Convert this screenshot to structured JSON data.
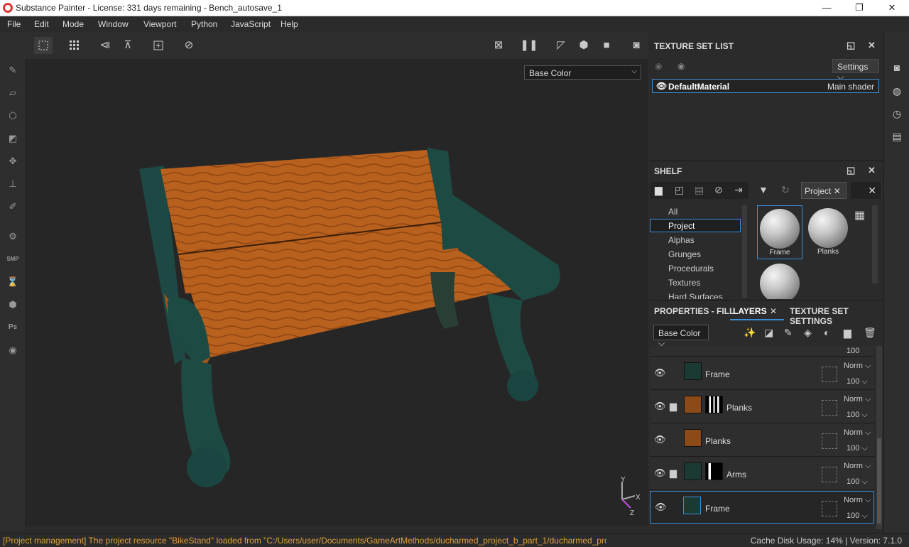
{
  "window": {
    "title": "Substance Painter - License: 331 days remaining - Bench_autosave_1",
    "minimize": "—",
    "maximize": "❐",
    "close": "✕"
  },
  "menu": [
    "File",
    "Edit",
    "Mode",
    "Window",
    "Viewport",
    "Python",
    "JavaScript",
    "Help"
  ],
  "viewport": {
    "channel": "Base Color",
    "axis_y": "Y",
    "axis_x": "X",
    "axis_z": "Z"
  },
  "texture_set_list": {
    "title": "TEXTURE SET LIST",
    "settings": "Settings",
    "items": [
      {
        "name": "DefaultMaterial",
        "shader": "Main shader"
      }
    ]
  },
  "shelf": {
    "title": "SHELF",
    "categories": [
      "All",
      "Project",
      "Alphas",
      "Grunges",
      "Procedurals",
      "Textures",
      "Hard Surfaces"
    ],
    "selected_category": "Project",
    "search_tag": "Project",
    "materials": [
      "Frame",
      "Planks"
    ]
  },
  "layers_panel": {
    "tabs": [
      "PROPERTIES - FILL",
      "LAYERS",
      "TEXTURE SET SETTINGS"
    ],
    "channel": "Base Color",
    "top_partial_opacity": "100",
    "layers": [
      {
        "name": "Frame",
        "blend": "Norm",
        "opacity": "100",
        "color": "#1b3a33",
        "folder": false,
        "mask": false
      },
      {
        "name": "Planks",
        "blend": "Norm",
        "opacity": "100",
        "color": "#8b4a18",
        "folder": true,
        "mask": true
      },
      {
        "name": "Planks",
        "blend": "Norm",
        "opacity": "100",
        "color": "#8b4a18",
        "folder": false,
        "mask": false
      },
      {
        "name": "Arms",
        "blend": "Norm",
        "opacity": "100",
        "color": "#1b3a33",
        "folder": true,
        "mask": true
      },
      {
        "name": "Frame",
        "blend": "Norm",
        "opacity": "100",
        "color": "#1b3a33",
        "folder": false,
        "mask": false,
        "selected": true
      }
    ]
  },
  "status": {
    "message": "[Project management] The project resource \"BikeStand\" loaded from \"C:/Users/user/Documents/GameArtMethods/ducharmed_project_b_part_1/ducharmed_project_b/sourc...",
    "cache": "Cache Disk Usage:   14% | Version: 7.1.0"
  },
  "colors": {
    "accent": "#3b8fd8",
    "wood": "#b8601e",
    "frame": "#1e4a44",
    "status_text": "#e0a13a"
  }
}
